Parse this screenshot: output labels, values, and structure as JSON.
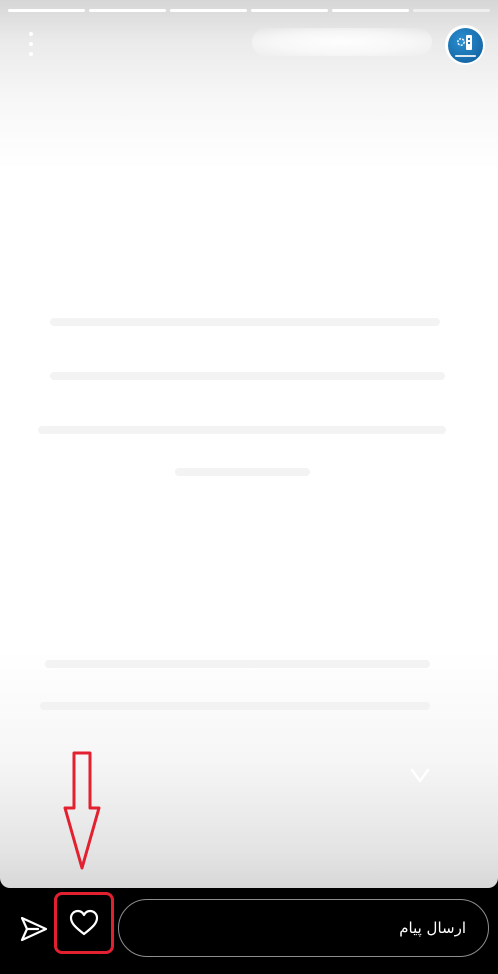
{
  "story": {
    "segments": [
      {
        "progress": 1.0
      },
      {
        "progress": 1.0
      },
      {
        "progress": 1.0
      },
      {
        "progress": 1.0
      },
      {
        "progress": 1.0
      },
      {
        "progress": 0.0
      }
    ],
    "account": {
      "name": "",
      "avatar_icon": "brand-logo-icon",
      "avatar_color": "#1a6fb5"
    },
    "menu_icon": "more-vertical-icon",
    "chevron_icon": "chevron-down-icon"
  },
  "reply_bar": {
    "share_icon": "send-paper-plane-icon",
    "like_icon": "heart-outline-icon",
    "message_placeholder": "ارسال پیام"
  },
  "annotation": {
    "arrow_icon": "arrow-down-outline-icon",
    "highlight_color": "#e3202f"
  }
}
